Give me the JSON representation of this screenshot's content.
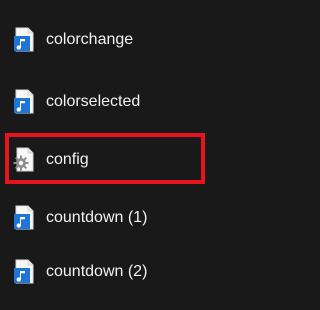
{
  "files": [
    {
      "name": "colorchange",
      "icon": "audio-file-icon"
    },
    {
      "name": "colorselected",
      "icon": "audio-file-icon"
    },
    {
      "name": "config",
      "icon": "settings-file-icon"
    },
    {
      "name": "countdown (1)",
      "icon": "audio-file-icon"
    },
    {
      "name": "countdown (2)",
      "icon": "audio-file-icon"
    }
  ],
  "highlight": {
    "target": "config",
    "color": "#e8141b"
  },
  "colors": {
    "background": "#191919",
    "text": "#f2f2f2",
    "audio_icon": "#1f74d8"
  }
}
